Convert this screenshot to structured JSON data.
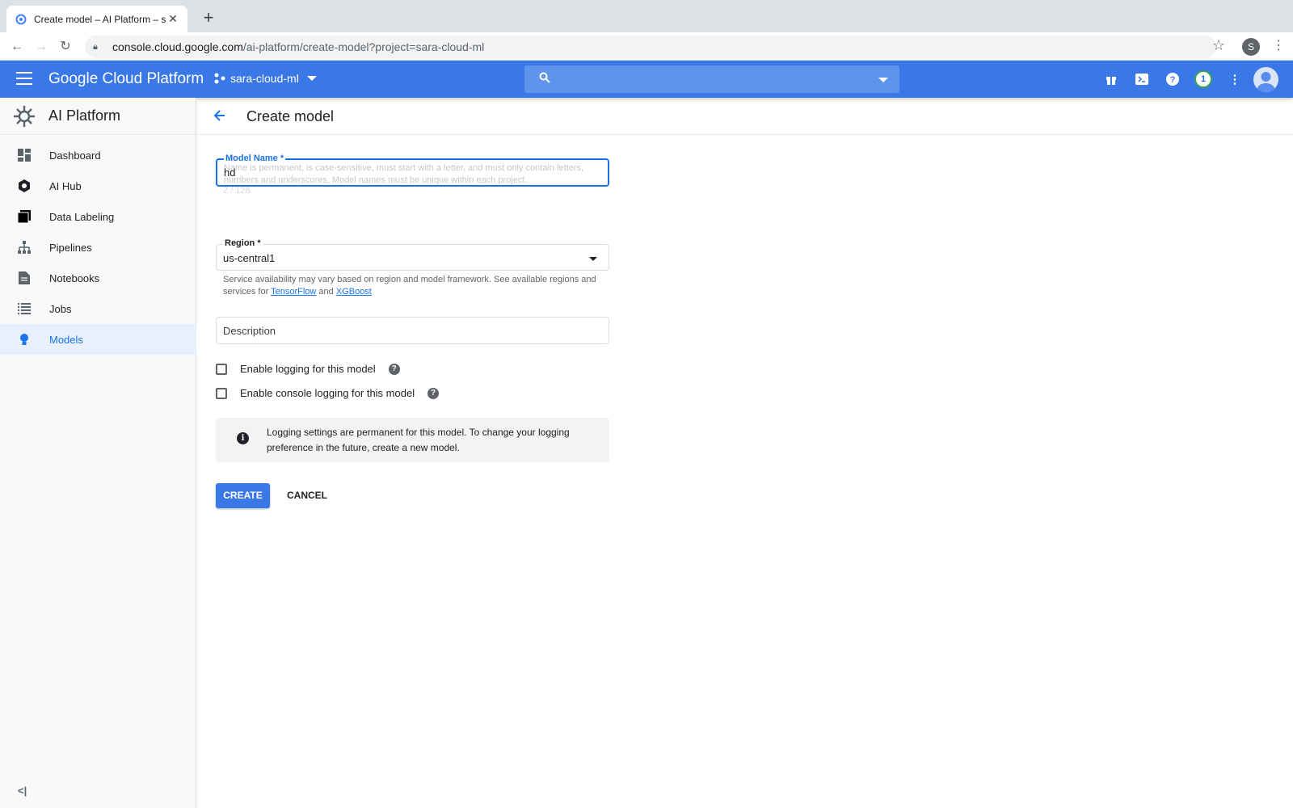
{
  "browser": {
    "tab_title": "Create model – AI Platform – sar",
    "url_host": "console.cloud.google.com",
    "url_path": "/ai-platform/create-model?project=sara-cloud-ml",
    "profile_initial": "S"
  },
  "header": {
    "brand": "Google Cloud Platform",
    "project": "sara-cloud-ml",
    "notifications_count": "1",
    "colors": {
      "bar": "#3b78e7",
      "search": "#5f94ec"
    }
  },
  "sidebar": {
    "product": "AI Platform",
    "items": [
      {
        "label": "Dashboard",
        "icon": "dashboard-icon"
      },
      {
        "label": "AI Hub",
        "icon": "ai-hub-icon"
      },
      {
        "label": "Data Labeling",
        "icon": "data-labeling-icon"
      },
      {
        "label": "Pipelines",
        "icon": "pipelines-icon"
      },
      {
        "label": "Notebooks",
        "icon": "notebooks-icon"
      },
      {
        "label": "Jobs",
        "icon": "jobs-icon"
      },
      {
        "label": "Models",
        "icon": "models-icon",
        "active": true
      }
    ],
    "collapse_label": "<|"
  },
  "page": {
    "title": "Create model",
    "model_name": {
      "label": "Model Name *",
      "value": "hd",
      "hint": "Name is permanent, is case-sensitive, must start with a letter, and must only contain letters, numbers and underscores. Model names must be unique within each project.",
      "counter": "2 / 128"
    },
    "region": {
      "label": "Region *",
      "value": "us-central1",
      "helper_text": "Service availability may vary based on region and model framework. See available regions and services for",
      "link_tensorflow": "TensorFlow",
      "helper_and": "and",
      "link_xgboost": "XGBoost"
    },
    "description": {
      "placeholder": "Description"
    },
    "enable_logging": {
      "label": "Enable logging for this model",
      "checked": false
    },
    "enable_console_logging": {
      "label": "Enable console logging for this model",
      "checked": false
    },
    "info": "Logging settings are permanent for this model. To change your logging preference in the future, create a new model.",
    "create_label": "CREATE",
    "cancel_label": "CANCEL"
  }
}
